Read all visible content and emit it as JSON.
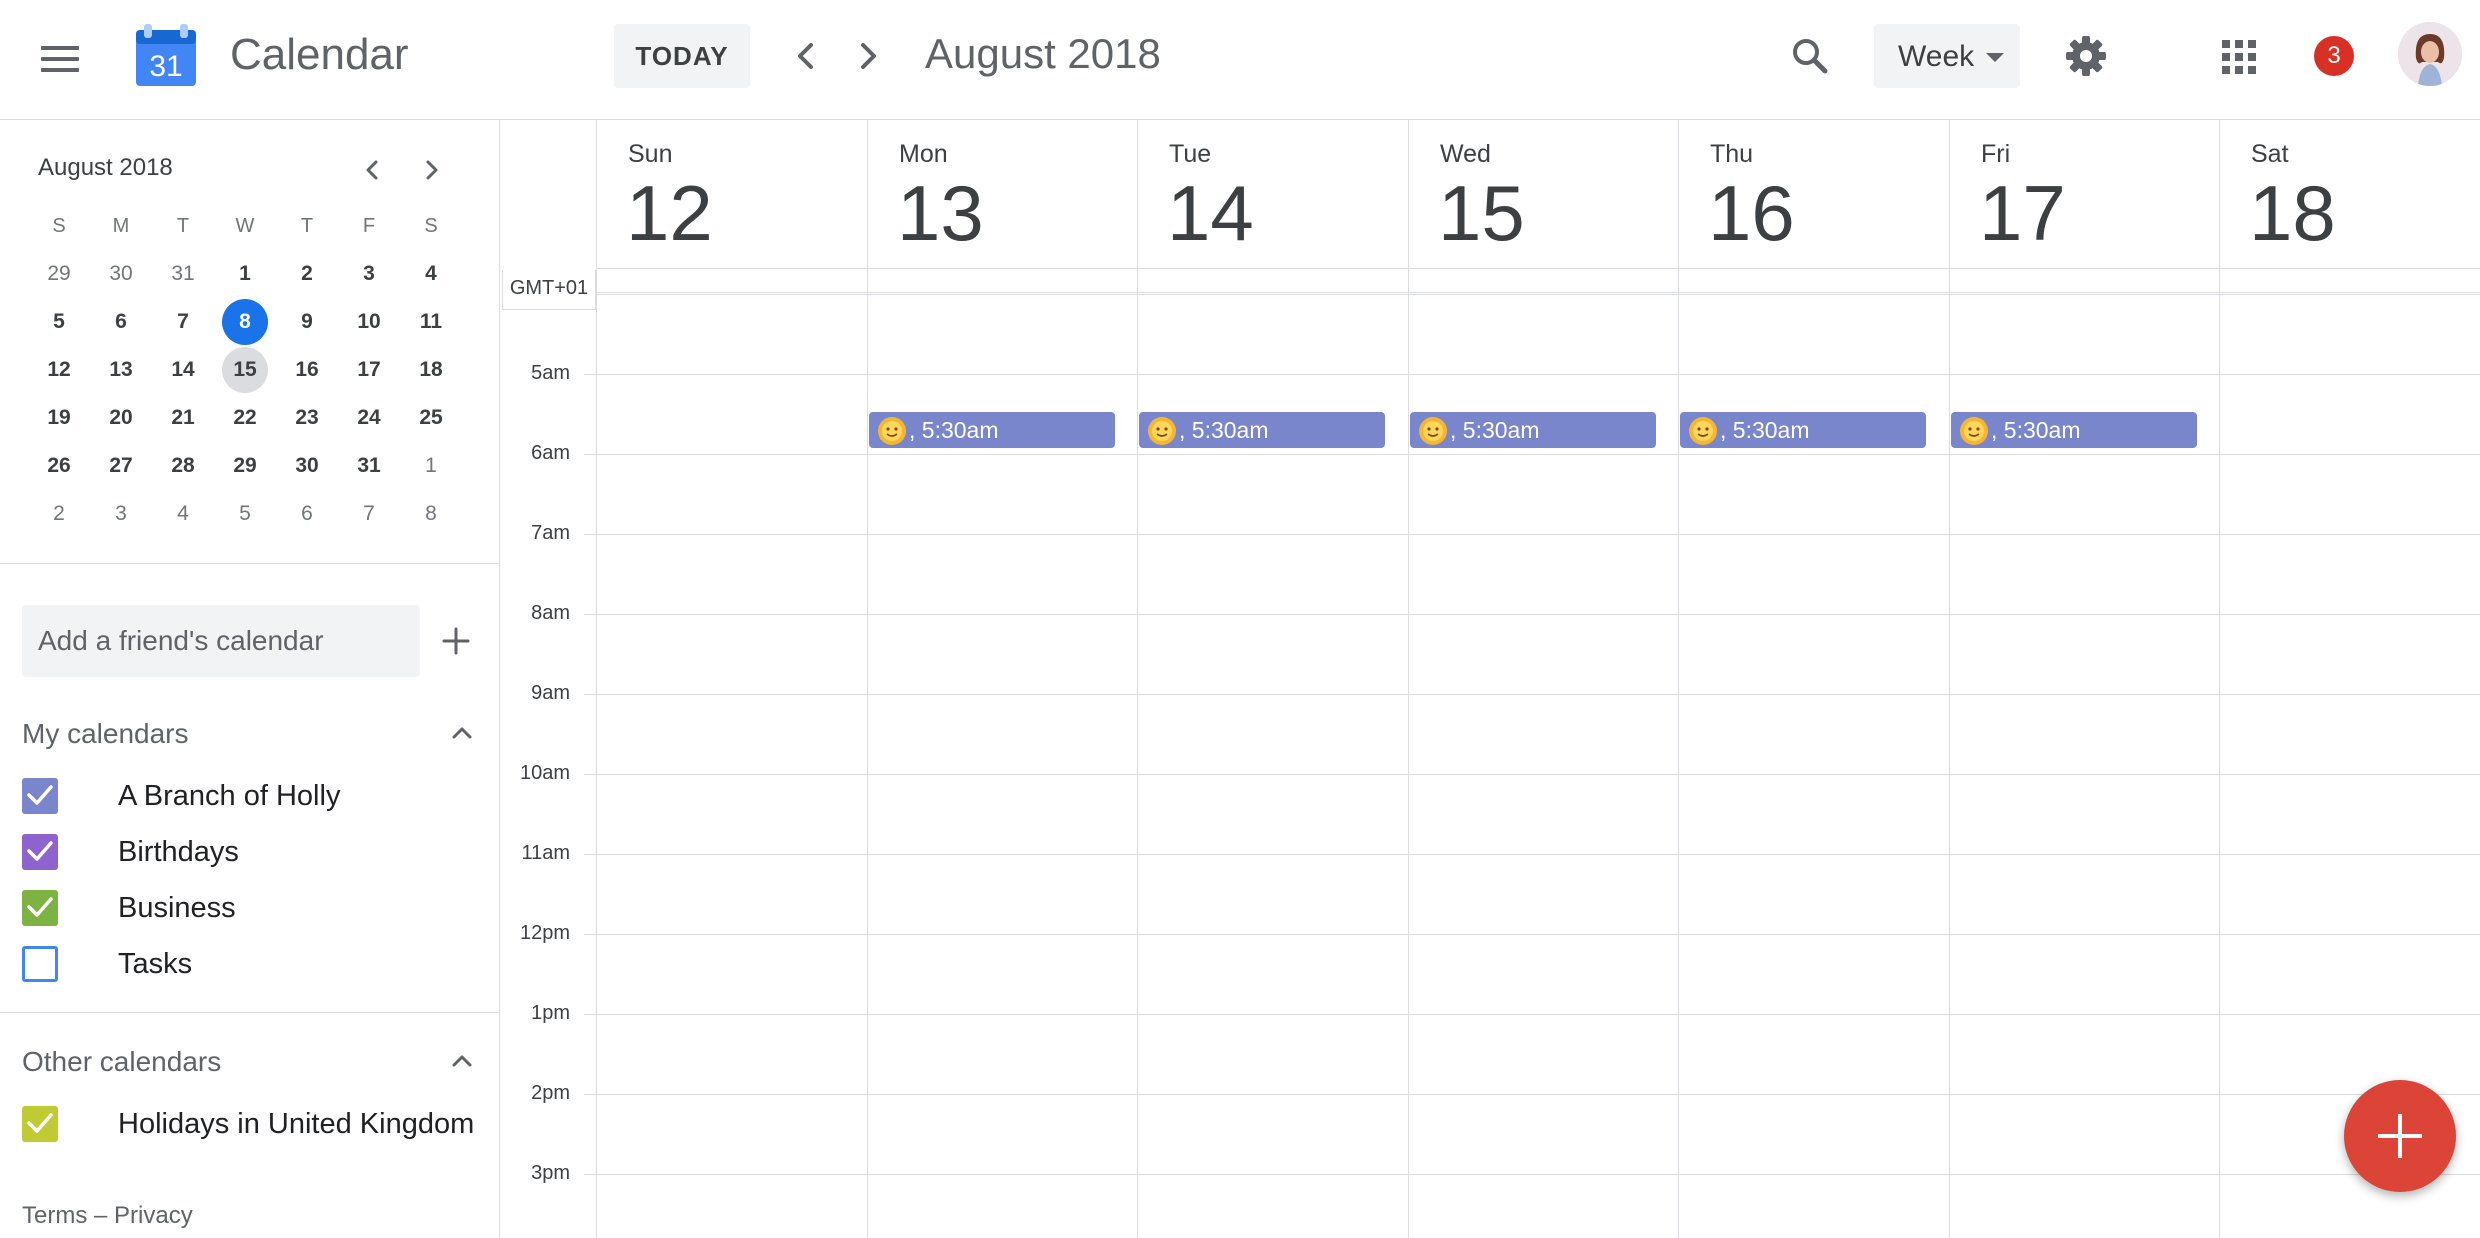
{
  "header": {
    "menu_icon": "hamburger-menu-icon",
    "logo_day": "31",
    "app_title": "Calendar",
    "today_label": "TODAY",
    "current_range": "August 2018",
    "view_label": "Week",
    "notification_count": "3",
    "icons": [
      "search-icon",
      "settings-gear-icon",
      "apps-grid-icon",
      "chevron-left-icon",
      "chevron-right-icon"
    ]
  },
  "sidebar": {
    "mini_calendar": {
      "title": "August 2018",
      "weekdays": [
        "S",
        "M",
        "T",
        "W",
        "T",
        "F",
        "S"
      ],
      "weeks": [
        [
          "29",
          "30",
          "31",
          "1",
          "2",
          "3",
          "4"
        ],
        [
          "5",
          "6",
          "7",
          "8",
          "9",
          "10",
          "11"
        ],
        [
          "12",
          "13",
          "14",
          "15",
          "16",
          "17",
          "18"
        ],
        [
          "19",
          "20",
          "21",
          "22",
          "23",
          "24",
          "25"
        ],
        [
          "26",
          "27",
          "28",
          "29",
          "30",
          "31",
          "1"
        ],
        [
          "2",
          "3",
          "4",
          "5",
          "6",
          "7",
          "8"
        ]
      ],
      "today": "8",
      "selected": "15"
    },
    "friend_placeholder": "Add a friend's calendar",
    "my_calendars_title": "My calendars",
    "my_calendars": [
      {
        "label": "A Branch of Holly",
        "checked": true,
        "color": "#7986cb"
      },
      {
        "label": "Birthdays",
        "checked": true,
        "color": "#8e63ce"
      },
      {
        "label": "Business",
        "checked": true,
        "color": "#7cb342"
      },
      {
        "label": "Tasks",
        "checked": false,
        "color": "#4285f4"
      }
    ],
    "other_calendars_title": "Other calendars",
    "other_calendars": [
      {
        "label": "Holidays in United Kingdom",
        "checked": true,
        "color": "#c0ca33"
      }
    ],
    "footer": {
      "terms": "Terms",
      "separator": " – ",
      "privacy": "Privacy"
    }
  },
  "week": {
    "timezone": "GMT+01",
    "days": [
      {
        "name": "Sun",
        "num": "12"
      },
      {
        "name": "Mon",
        "num": "13"
      },
      {
        "name": "Tue",
        "num": "14"
      },
      {
        "name": "Wed",
        "num": "15"
      },
      {
        "name": "Thu",
        "num": "16"
      },
      {
        "name": "Fri",
        "num": "17"
      },
      {
        "name": "Sat",
        "num": "18"
      }
    ],
    "hours": [
      "5am",
      "6am",
      "7am",
      "8am",
      "9am",
      "10am",
      "11am",
      "12pm",
      "1pm",
      "2pm",
      "3pm"
    ],
    "events": [
      {
        "day": "Mon",
        "title": ", 5:30am",
        "icon": "sun-emoji-icon",
        "color": "#7986cb"
      },
      {
        "day": "Tue",
        "title": ", 5:30am",
        "icon": "sun-emoji-icon",
        "color": "#7986cb"
      },
      {
        "day": "Wed",
        "title": ", 5:30am",
        "icon": "sun-emoji-icon",
        "color": "#7986cb"
      },
      {
        "day": "Thu",
        "title": ", 5:30am",
        "icon": "sun-emoji-icon",
        "color": "#7986cb"
      },
      {
        "day": "Fri",
        "title": ", 5:30am",
        "icon": "sun-emoji-icon",
        "color": "#7986cb"
      }
    ]
  },
  "fab": {
    "icon": "plus-icon",
    "color": "#db4437"
  }
}
